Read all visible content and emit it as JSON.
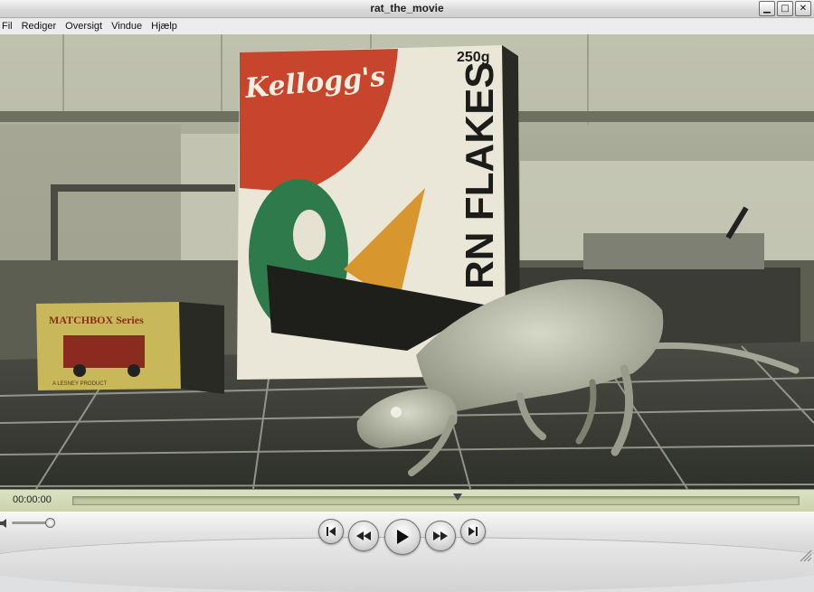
{
  "window": {
    "title": "rat_the_movie"
  },
  "menu": [
    "Fil",
    "Rediger",
    "Oversigt",
    "Vindue",
    "Hjælp"
  ],
  "scene": {
    "cereal_brand": "Kellogg's",
    "cereal_weight": "250g",
    "cereal_name": "RN FLAKES",
    "matchbox_label": "MATCHBOX Series",
    "matchbox_sub": "A LESNEY PRODUCT"
  },
  "playback": {
    "time": "00:00:00",
    "position_fraction": 0.53
  },
  "volume": {
    "level_fraction": 0.95
  },
  "icons": {
    "minimize": "minimize-icon",
    "maximize": "maximize-icon",
    "close": "close-icon",
    "speaker": "speaker-icon",
    "previous": "skip-back-icon",
    "rewind": "rewind-icon",
    "play": "play-icon",
    "forward": "fast-forward-icon",
    "next": "skip-forward-icon"
  }
}
